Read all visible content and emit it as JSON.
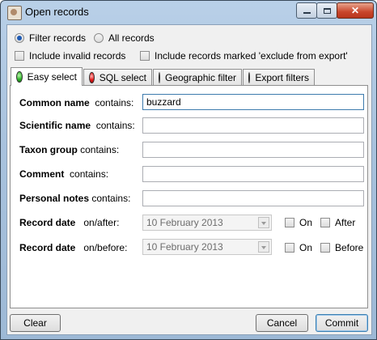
{
  "window": {
    "title": "Open records"
  },
  "filter_mode": {
    "options": [
      {
        "label": "Filter records",
        "selected": true
      },
      {
        "label": "All records",
        "selected": false
      }
    ]
  },
  "flags": {
    "include_invalid": {
      "label": "Include invalid records",
      "checked": false
    },
    "include_excluded": {
      "label": "Include records marked 'exclude from export'",
      "checked": false
    }
  },
  "tabs": [
    {
      "label": "Easy select",
      "status": "green",
      "active": true
    },
    {
      "label": "SQL select",
      "status": "red",
      "active": false
    },
    {
      "label": "Geographic filter",
      "status": "red",
      "active": false
    },
    {
      "label": "Export filters",
      "status": "red",
      "active": false
    }
  ],
  "easy_select": {
    "fields": [
      {
        "name": "Common name",
        "op": "contains:",
        "value": "buzzard"
      },
      {
        "name": "Scientific name",
        "op": "contains:",
        "value": ""
      },
      {
        "name": "Taxon group",
        "op": "contains:",
        "value": ""
      },
      {
        "name": "Comment",
        "op": "contains:",
        "value": ""
      },
      {
        "name": "Personal notes",
        "op": "contains:",
        "value": ""
      }
    ],
    "dates": [
      {
        "name": "Record date",
        "op": "on/after:",
        "value": "10  February  2013",
        "check1": "On",
        "check2": "After"
      },
      {
        "name": "Record date",
        "op": "on/before:",
        "value": "10  February  2013",
        "check1": "On",
        "check2": "Before"
      }
    ]
  },
  "footer": {
    "clear": "Clear",
    "cancel": "Cancel",
    "commit": "Commit"
  }
}
